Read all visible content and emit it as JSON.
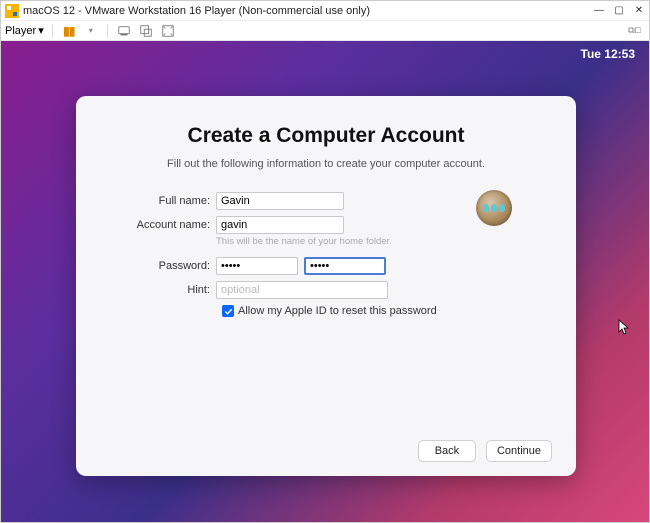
{
  "window": {
    "title": "macOS 12 - VMware Workstation 16 Player (Non-commercial use only)",
    "minimize": "—",
    "maximize": "▢",
    "close": "✕"
  },
  "toolbar": {
    "player_label": "Player",
    "dropdown_glyph": "▾",
    "screenshot_label": "⧉⧠"
  },
  "menubar": {
    "time": "Tue 12:53"
  },
  "dialog": {
    "title": "Create a Computer Account",
    "subtitle": "Fill out the following information to create your computer account.",
    "labels": {
      "full_name": "Full name:",
      "account_name": "Account name:",
      "password": "Password:",
      "hint": "Hint:"
    },
    "values": {
      "full_name": "Gavin",
      "account_name": "gavin",
      "password": "•••••",
      "password_confirm": "•••••",
      "hint": ""
    },
    "placeholders": {
      "hint": "optional"
    },
    "helper_text": "This will be the name of your home folder.",
    "allow_appleid_label": "Allow my Apple ID to reset this password",
    "allow_appleid_checked": true,
    "buttons": {
      "back": "Back",
      "continue": "Continue"
    }
  }
}
